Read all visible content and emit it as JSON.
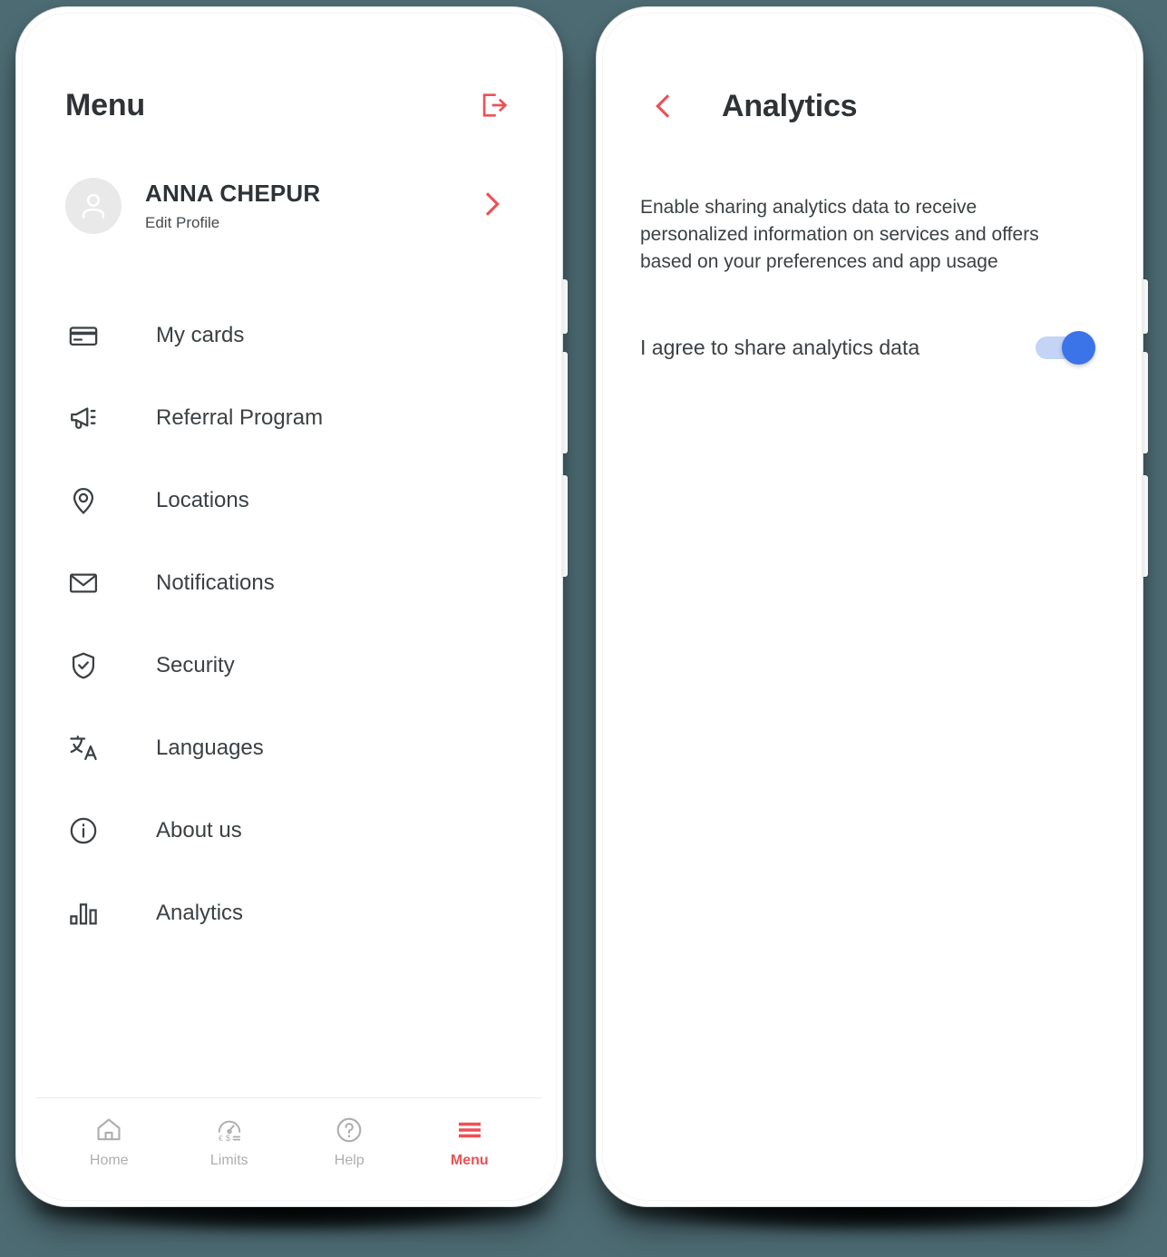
{
  "theme": {
    "accent_red": "#ec5156",
    "text_dark": "#3c4043",
    "toggle_on_thumb": "#3b73e8",
    "toggle_on_track": "#c3d4f7",
    "background": "#4d6b73"
  },
  "left_screen": {
    "header": {
      "title": "Menu",
      "logout_icon": "logout-icon"
    },
    "profile": {
      "name": "ANNA CHEPUR",
      "subtitle": "Edit Profile",
      "avatar_icon": "user-avatar-icon",
      "chevron_icon": "chevron-right-icon"
    },
    "menu_items": [
      {
        "label": "My cards",
        "icon": "credit-card-icon"
      },
      {
        "label": "Referral Program",
        "icon": "megaphone-icon"
      },
      {
        "label": "Locations",
        "icon": "map-pin-icon"
      },
      {
        "label": "Notifications",
        "icon": "envelope-icon"
      },
      {
        "label": "Security",
        "icon": "shield-check-icon"
      },
      {
        "label": "Languages",
        "icon": "translate-icon"
      },
      {
        "label": "About us",
        "icon": "info-circle-icon"
      },
      {
        "label": "Analytics",
        "icon": "bar-chart-icon"
      }
    ],
    "bottom_nav": [
      {
        "label": "Home",
        "icon": "home-icon",
        "active": false
      },
      {
        "label": "Limits",
        "icon": "speedometer-icon",
        "active": false
      },
      {
        "label": "Help",
        "icon": "question-icon",
        "active": false
      },
      {
        "label": "Menu",
        "icon": "hamburger-icon",
        "active": true
      }
    ]
  },
  "right_screen": {
    "header": {
      "title": "Analytics",
      "back_icon": "chevron-left-icon"
    },
    "description": "Enable sharing analytics data to receive personalized information on services and offers based on your preferences and app usage",
    "toggle": {
      "label": "I agree to share analytics data",
      "state": "on"
    }
  }
}
